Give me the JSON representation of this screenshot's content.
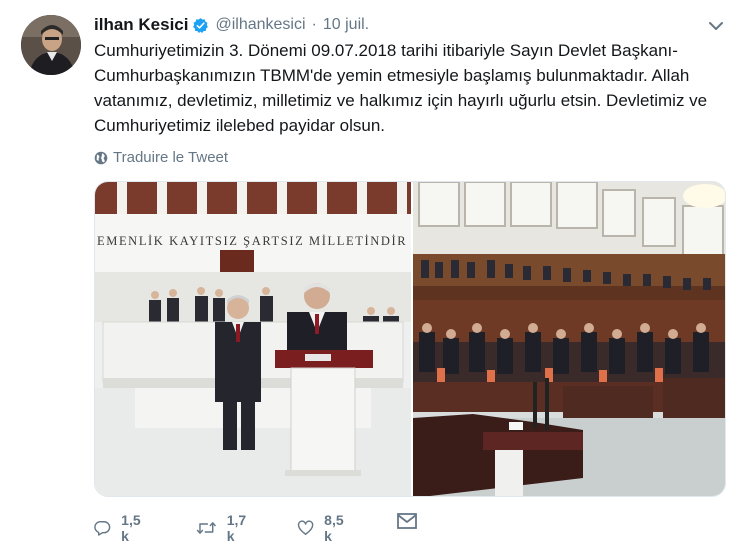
{
  "tweet": {
    "author_name": "ilhan Kesici",
    "handle": "@ilhankesici",
    "separator": "·",
    "date": "10 juil.",
    "text": "Cumhuriyetimizin 3. Dönemi 09.07.2018 tarihi itibariyle Sayın Devlet Başkanı-Cumhurbaşkanımızın TBMM'de yemin etmesiyle başlamış bulunmaktadır. Allah vatanımız, devletimiz, milletimiz ve halkımız için hayırlı uğurlu etsin. Devletimiz ve Cumhuriyetimiz ilelebed payidar olsun.",
    "translate_label": "Traduire le Tweet",
    "verified": true
  },
  "media": {
    "photo1_inscription": "EMENLİK KAYITSIZ ŞARTSIZ MİLLETİNDİR"
  },
  "actions": {
    "reply_count": "1,5 k",
    "retweet_count": "1,7 k",
    "like_count": "8,5 k"
  },
  "icons": {
    "verified": "verified-badge-icon",
    "chevron": "chevron-down-icon",
    "globe": "globe-icon",
    "reply": "reply-icon",
    "retweet": "retweet-icon",
    "like": "heart-icon",
    "dm": "envelope-icon"
  },
  "colors": {
    "primary_text": "#14171a",
    "secondary_text": "#657786",
    "verified_blue": "#1da1f2",
    "border": "#e1e8ed"
  }
}
